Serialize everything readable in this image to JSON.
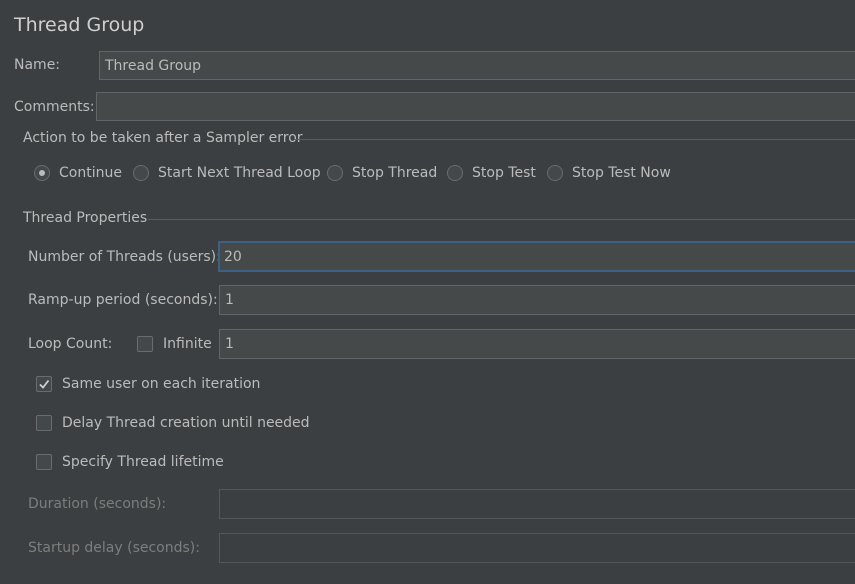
{
  "panel": {
    "title": "Thread Group"
  },
  "name_field": {
    "label": "Name:",
    "value": "Thread Group"
  },
  "comments_field": {
    "label": "Comments:",
    "value": ""
  },
  "sampler_error": {
    "title": "Action to be taken after a Sampler error",
    "selected": "Continue",
    "options": [
      "Continue",
      "Start Next Thread Loop",
      "Stop Thread",
      "Stop Test",
      "Stop Test Now"
    ]
  },
  "thread_properties": {
    "title": "Thread Properties",
    "num_threads": {
      "label": "Number of Threads (users):",
      "value": "20"
    },
    "ramp_up": {
      "label": "Ramp-up period (seconds):",
      "value": "1"
    },
    "loop_count": {
      "label": "Loop Count:",
      "infinite_label": "Infinite",
      "infinite_checked": false,
      "value": "1"
    },
    "same_user": {
      "label": "Same user on each iteration",
      "checked": true
    },
    "delay_creation": {
      "label": "Delay Thread creation until needed",
      "checked": false
    },
    "specify_lifetime": {
      "label": "Specify Thread lifetime",
      "checked": false
    },
    "duration": {
      "label": "Duration (seconds):",
      "value": ""
    },
    "startup_delay": {
      "label": "Startup delay (seconds):",
      "value": ""
    }
  },
  "icons": {
    "check": "check-icon"
  }
}
